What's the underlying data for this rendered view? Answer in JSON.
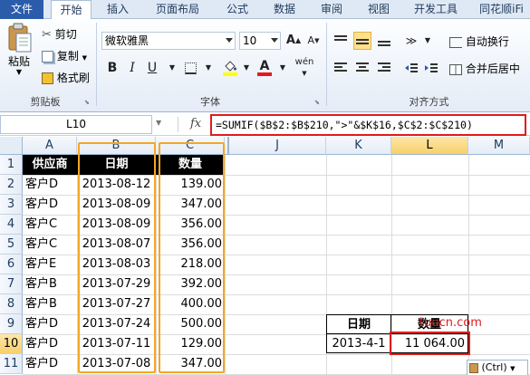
{
  "tabs": [
    {
      "label": "文件"
    },
    {
      "label": "开始"
    },
    {
      "label": "插入"
    },
    {
      "label": "页面布局"
    },
    {
      "label": "公式"
    },
    {
      "label": "数据"
    },
    {
      "label": "审阅"
    },
    {
      "label": "视图"
    },
    {
      "label": "开发工具"
    },
    {
      "label": "同花顺iFi"
    }
  ],
  "ribbon": {
    "clipboard": {
      "paste": "粘贴",
      "cut": "剪切",
      "copy": "复制",
      "format_painter": "格式刷",
      "group": "剪贴板"
    },
    "font": {
      "name": "微软雅黑",
      "size": "10",
      "bold": "B",
      "italic": "I",
      "underline": "U",
      "grow": "A",
      "shrink": "A",
      "font_color_letter": "A",
      "phonetic": "wén",
      "group": "字体"
    },
    "alignment": {
      "wrap_text": "自动换行",
      "merge_center": "合并后居中",
      "group": "对齐方式"
    },
    "colors": {
      "font_color_bar": "#e11b1b",
      "fill_color_bar": "#ffff00"
    }
  },
  "formula_bar": {
    "name_box": "L10",
    "fx": "fx",
    "formula": "=SUMIF($B$2:$B$210,\">\"&$K$16,$C$2:$C$210)"
  },
  "columns": [
    "A",
    "B",
    "C",
    "J",
    "K",
    "L",
    "M"
  ],
  "rows": [
    "1",
    "2",
    "3",
    "4",
    "5",
    "6",
    "7",
    "8",
    "9",
    "10",
    "11"
  ],
  "table": {
    "headers": [
      "供应商",
      "日期",
      "数量"
    ],
    "rows": [
      [
        "客户D",
        "2013-08-12",
        "139.00"
      ],
      [
        "客户D",
        "2013-08-09",
        "347.00"
      ],
      [
        "客户C",
        "2013-08-09",
        "356.00"
      ],
      [
        "客户C",
        "2013-08-07",
        "356.00"
      ],
      [
        "客户E",
        "2013-08-03",
        "218.00"
      ],
      [
        "客户B",
        "2013-07-29",
        "392.00"
      ],
      [
        "客户B",
        "2013-07-27",
        "400.00"
      ],
      [
        "客户D",
        "2013-07-24",
        "500.00"
      ],
      [
        "客户D",
        "2013-07-11",
        "129.00"
      ],
      [
        "客户D",
        "2013-07-08",
        "347.00"
      ]
    ]
  },
  "summary": {
    "headers": [
      "日期",
      "数量"
    ],
    "date": "2013-4-1",
    "quantity": "11 064.00"
  },
  "watermark": "tuucn.com",
  "paste_options": "(Ctrl)"
}
